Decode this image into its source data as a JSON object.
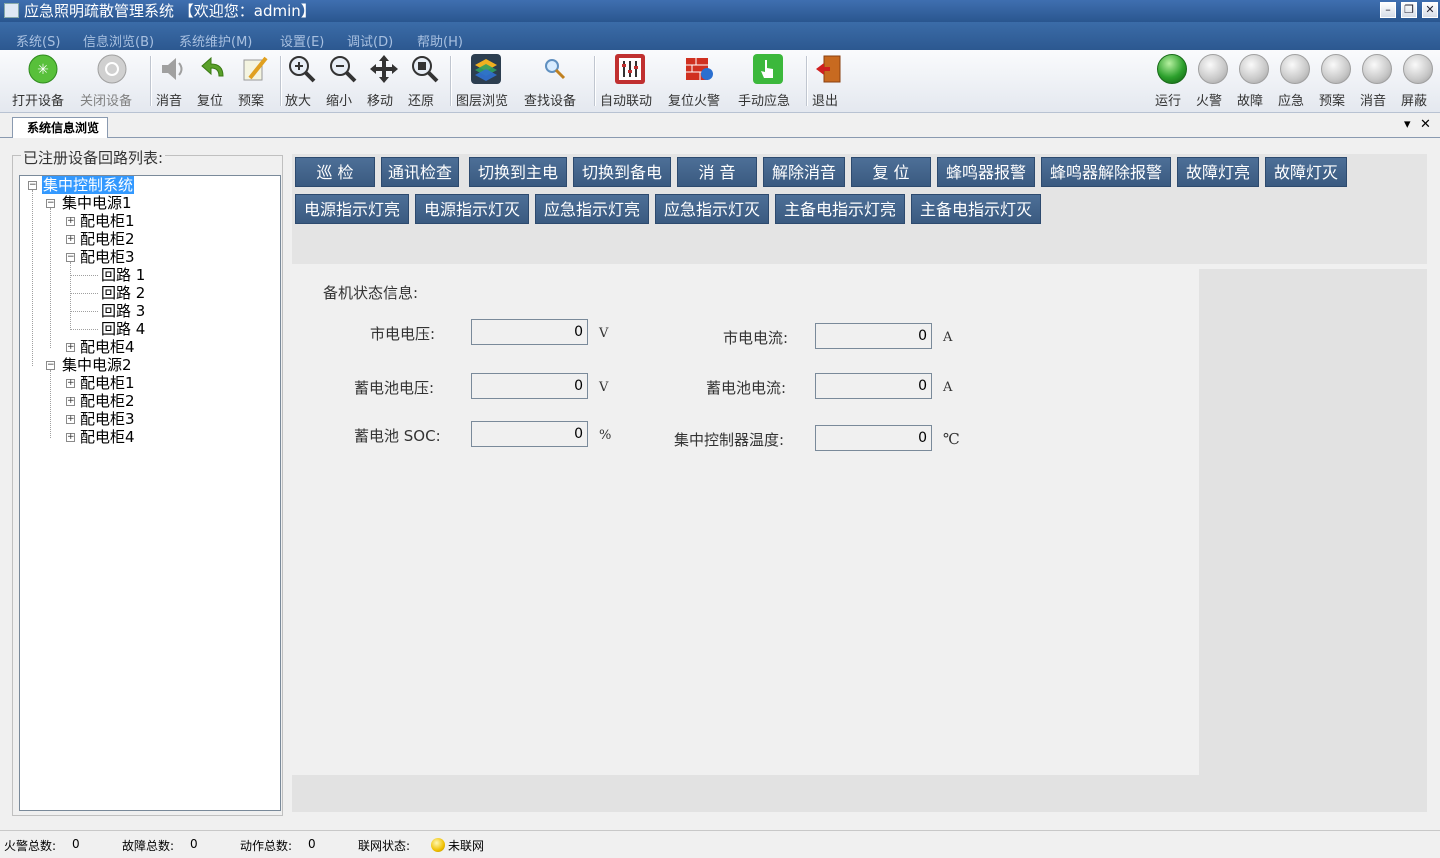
{
  "window": {
    "title": "应急照明疏散管理系统  【欢迎您：admin】"
  },
  "menu": [
    "系统(S)",
    "信息浏览(B)",
    "系统维护(M)",
    "设置(E)",
    "调试(D)",
    "帮助(H)"
  ],
  "toolbar": {
    "open_device": "打开设备",
    "close_device": "关闭设备",
    "mute": "消音",
    "reset": "复位",
    "plan": "预案",
    "zoom_in": "放大",
    "zoom_out": "缩小",
    "move": "移动",
    "restore": "还原",
    "layers": "图层浏览",
    "find_device": "查找设备",
    "auto_link": "自动联动",
    "reset_fire": "复位火警",
    "manual_emergency": "手动应急",
    "exit": "退出"
  },
  "indicators": {
    "run": "运行",
    "fire": "火警",
    "fault": "故障",
    "emergency": "应急",
    "plan": "预案",
    "mute": "消音",
    "shield": "屏蔽"
  },
  "tab": {
    "label": "系统信息浏览"
  },
  "tree": {
    "legend": "已注册设备回路列表:",
    "root": "集中控制系统",
    "ps1": "集中电源1",
    "ps1_cab1": "配电柜1",
    "ps1_cab2": "配电柜2",
    "ps1_cab3": "配电柜3",
    "loop1": "回路 1",
    "loop2": "回路 2",
    "loop3": "回路 3",
    "loop4": "回路 4",
    "ps1_cab4": "配电柜4",
    "ps2": "集中电源2",
    "ps2_cab1": "配电柜1",
    "ps2_cab2": "配电柜2",
    "ps2_cab3": "配电柜3",
    "ps2_cab4": "配电柜4"
  },
  "commands": {
    "patrol": "巡  检",
    "comm_check": "通讯检查",
    "switch_main": "切换到主电",
    "switch_backup": "切换到备电",
    "mute": "消  音",
    "unmute": "解除消音",
    "reset": "复  位",
    "buzzer_alarm": "蜂鸣器报警",
    "buzzer_clear": "蜂鸣器解除报警",
    "fault_on": "故障灯亮",
    "fault_off": "故障灯灭",
    "power_on": "电源指示灯亮",
    "power_off": "电源指示灯灭",
    "emerg_on": "应急指示灯亮",
    "emerg_off": "应急指示灯灭",
    "mainbak_on": "主备电指示灯亮",
    "mainbak_off": "主备电指示灯灭"
  },
  "status_info": {
    "heading": "备机状态信息:",
    "mains_voltage_label": "市电电压:",
    "mains_voltage": "0",
    "mains_voltage_unit": "V",
    "mains_current_label": "市电电流:",
    "mains_current": "0",
    "mains_current_unit": "A",
    "battery_voltage_label": "蓄电池电压:",
    "battery_voltage": "0",
    "battery_voltage_unit": "V",
    "battery_current_label": "蓄电池电流:",
    "battery_current": "0",
    "battery_current_unit": "A",
    "battery_soc_label": "蓄电池 SOC:",
    "battery_soc": "0",
    "battery_soc_unit": "%",
    "controller_temp_label": "集中控制器温度:",
    "controller_temp": "0",
    "controller_temp_unit": "℃"
  },
  "statusbar": {
    "fire_total_label": "火警总数:",
    "fire_total": "0",
    "fault_total_label": "故障总数:",
    "fault_total": "0",
    "action_total_label": "动作总数:",
    "action_total": "0",
    "network_label": "联网状态:",
    "network_state": "未联网"
  },
  "colors": {
    "title_bar": "#2e5c95",
    "command_button": "#44668f",
    "selected_node": "#3399ff",
    "run_lamp": "#2ca02c",
    "network_dot": "#f0c000"
  }
}
